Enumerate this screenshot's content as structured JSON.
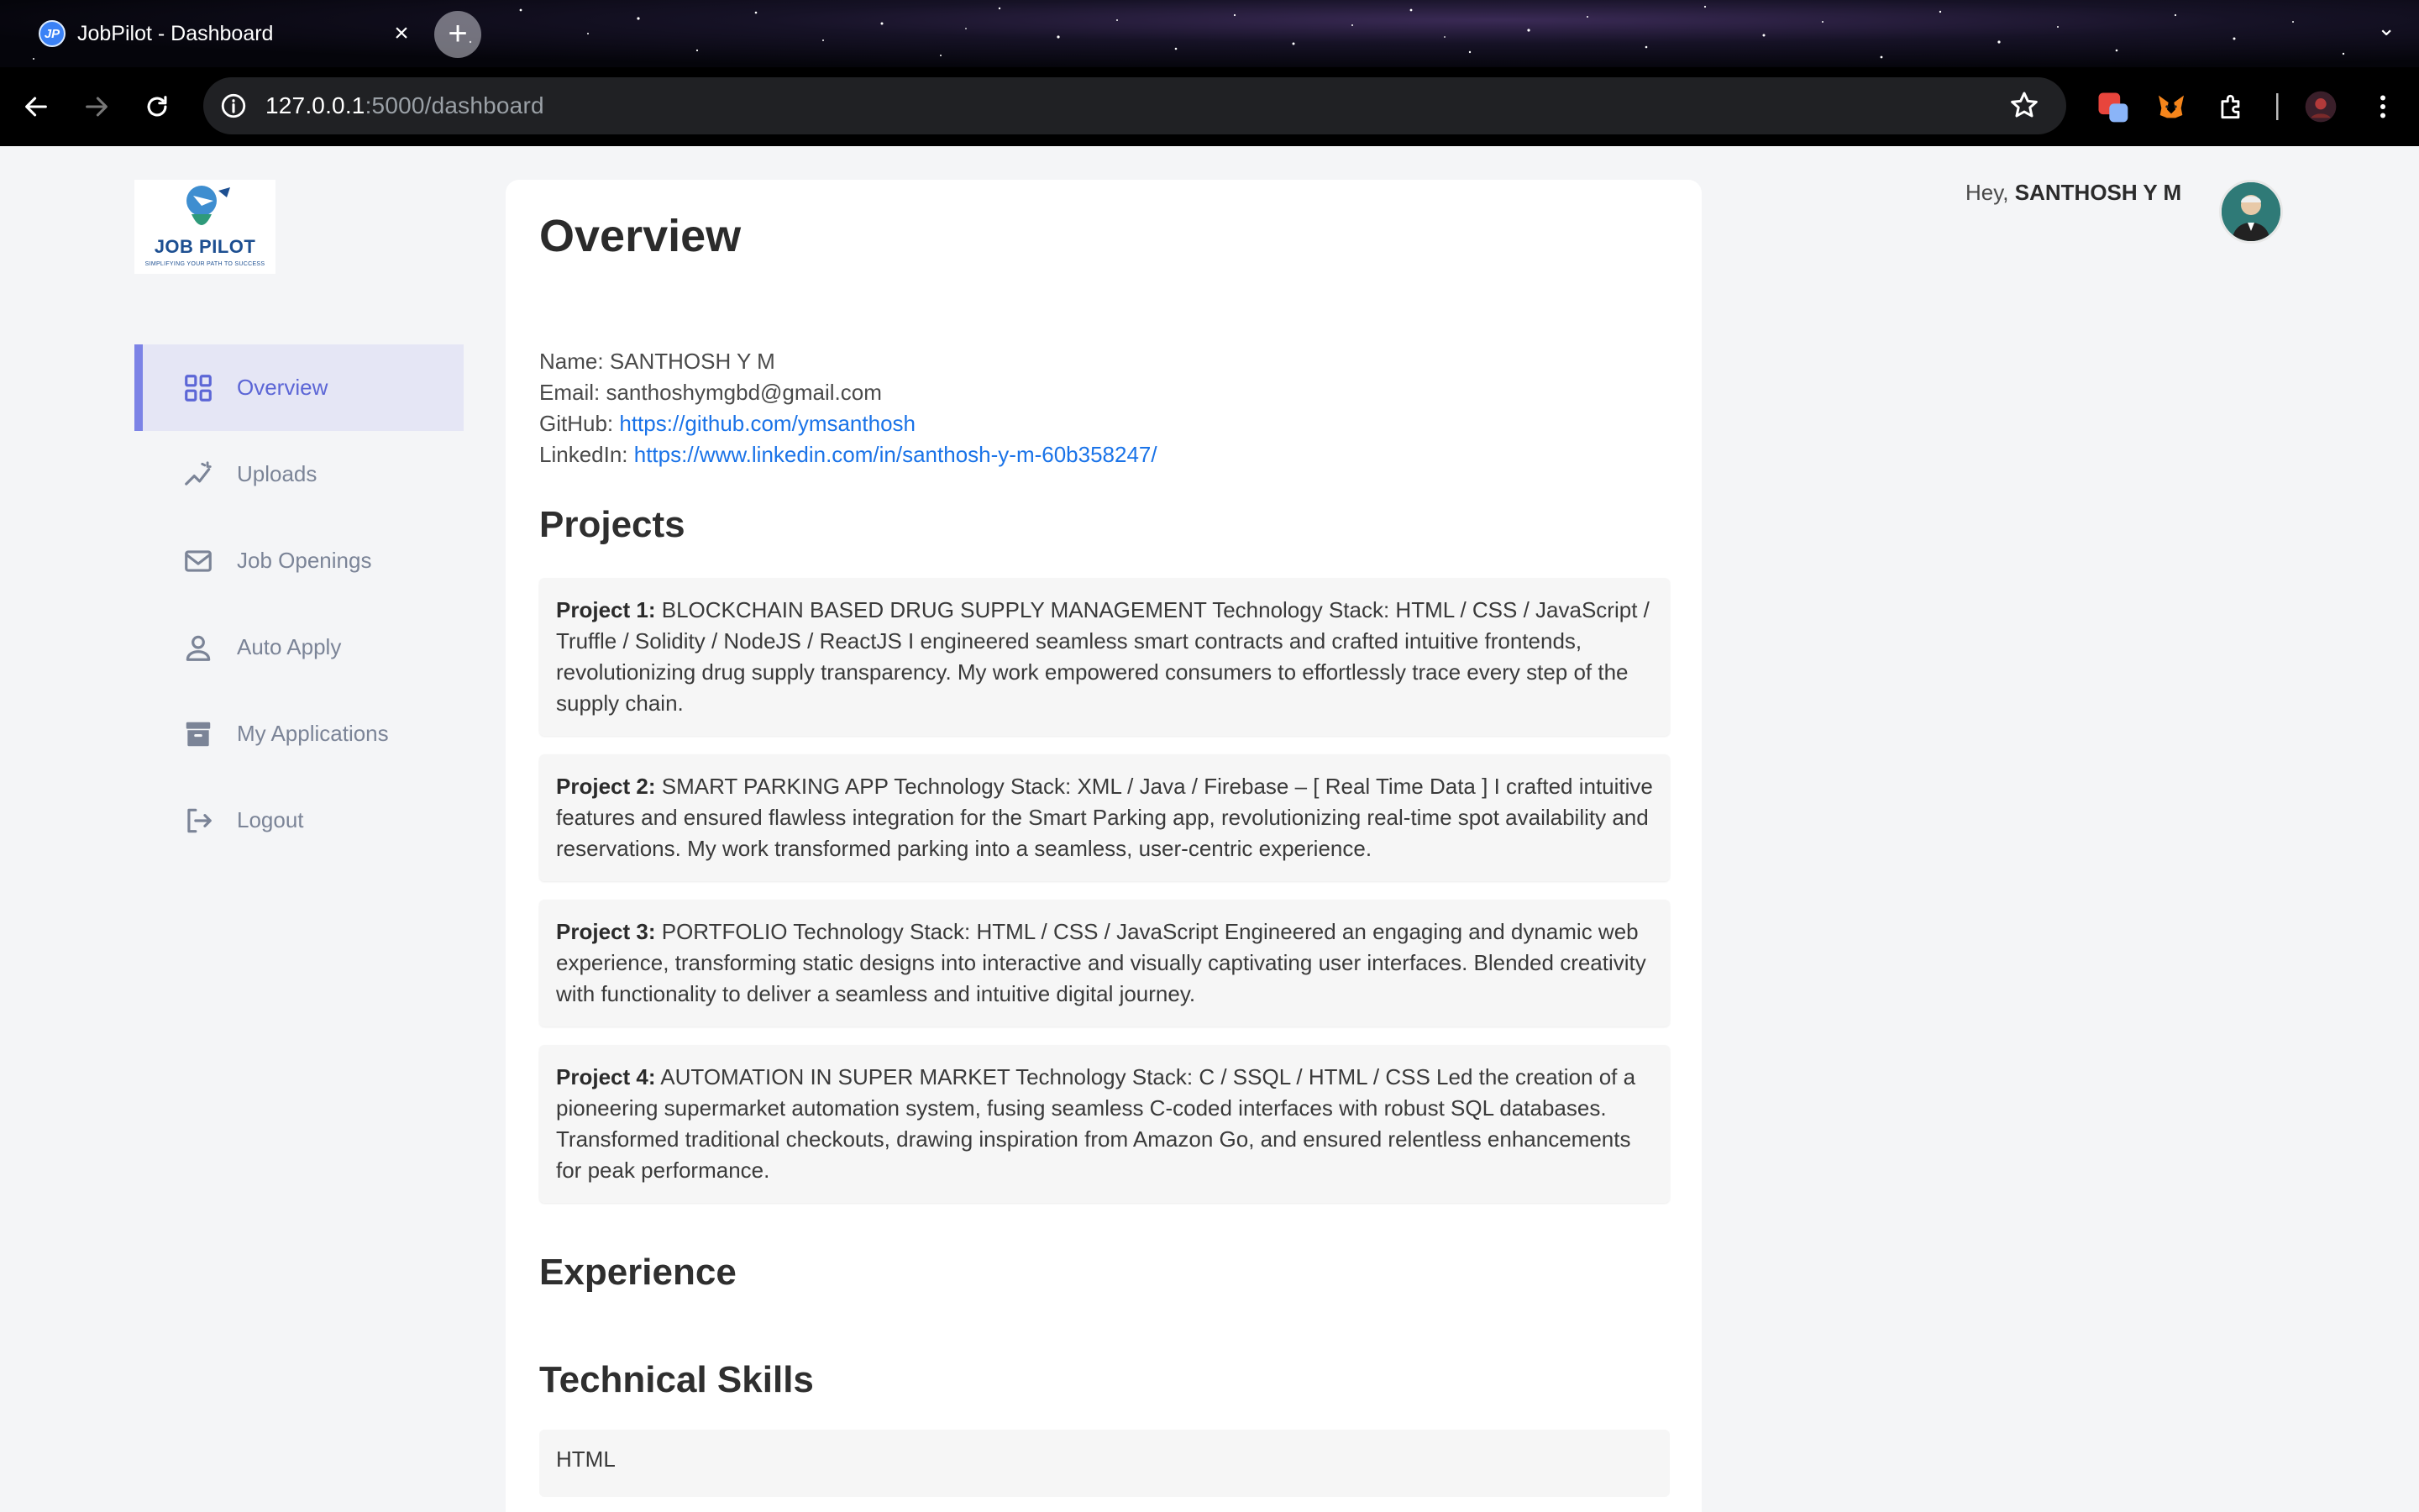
{
  "browser": {
    "tab_title": "JobPilot - Dashboard",
    "favicon_text": "JP",
    "url_host": "127.0.0.1",
    "url_path": ":5000/dashboard"
  },
  "logo": {
    "title": "JOB PILOT",
    "tagline": "SIMPLIFYING YOUR PATH TO SUCCESS"
  },
  "sidebar": {
    "items": [
      {
        "label": "Overview",
        "icon": "grid-icon",
        "active": true
      },
      {
        "label": "Uploads",
        "icon": "trend-icon",
        "active": false
      },
      {
        "label": "Job Openings",
        "icon": "mail-icon",
        "active": false
      },
      {
        "label": "Auto Apply",
        "icon": "user-icon",
        "active": false
      },
      {
        "label": "My Applications",
        "icon": "archive-icon",
        "active": false
      },
      {
        "label": "Logout",
        "icon": "logout-icon",
        "active": false
      }
    ]
  },
  "header": {
    "greeting_prefix": "Hey, ",
    "user_name": "SANTHOSH Y M"
  },
  "overview": {
    "title": "Overview",
    "name_label": "Name: ",
    "name": "SANTHOSH Y M",
    "email_label": "Email: ",
    "email": "santhoshymgbd@gmail.com",
    "github_label": "GitHub: ",
    "github": "https://github.com/ymsanthosh",
    "linkedin_label": "LinkedIn: ",
    "linkedin": "https://www.linkedin.com/in/santhosh-y-m-60b358247/"
  },
  "projects": {
    "title": "Projects",
    "items": [
      {
        "label": "Project 1:",
        "text": "BLOCKCHAIN BASED DRUG SUPPLY MANAGEMENT Technology Stack: HTML / CSS / JavaScript / Truffle / Solidity / NodeJS / ReactJS I engineered seamless smart contracts and crafted intuitive frontends, revolutionizing drug supply transparency. My work empowered consumers to effortlessly trace every step of the supply chain."
      },
      {
        "label": "Project 2:",
        "text": "SMART PARKING APP Technology Stack: XML / Java / Firebase – [ Real Time Data ] I crafted intuitive features and ensured flawless integration for the Smart Parking app, revolutionizing real-time spot availability and reservations. My work transformed parking into a seamless, user-centric experience."
      },
      {
        "label": "Project 3:",
        "text": "PORTFOLIO Technology Stack: HTML / CSS / JavaScript Engineered an engaging and dynamic web experience, transforming static designs into interactive and visually captivating user interfaces. Blended creativity with functionality to deliver a seamless and intuitive digital journey."
      },
      {
        "label": "Project 4:",
        "text": "AUTOMATION IN SUPER MARKET Technology Stack: C / SSQL / HTML / CSS Led the creation of a pioneering supermarket automation system, fusing seamless C-coded interfaces with robust SQL databases. Transformed traditional checkouts, drawing inspiration from Amazon Go, and ensured relentless enhancements for peak performance."
      }
    ]
  },
  "experience": {
    "title": "Experience"
  },
  "skills": {
    "title": "Technical Skills",
    "items": [
      "HTML"
    ]
  }
}
